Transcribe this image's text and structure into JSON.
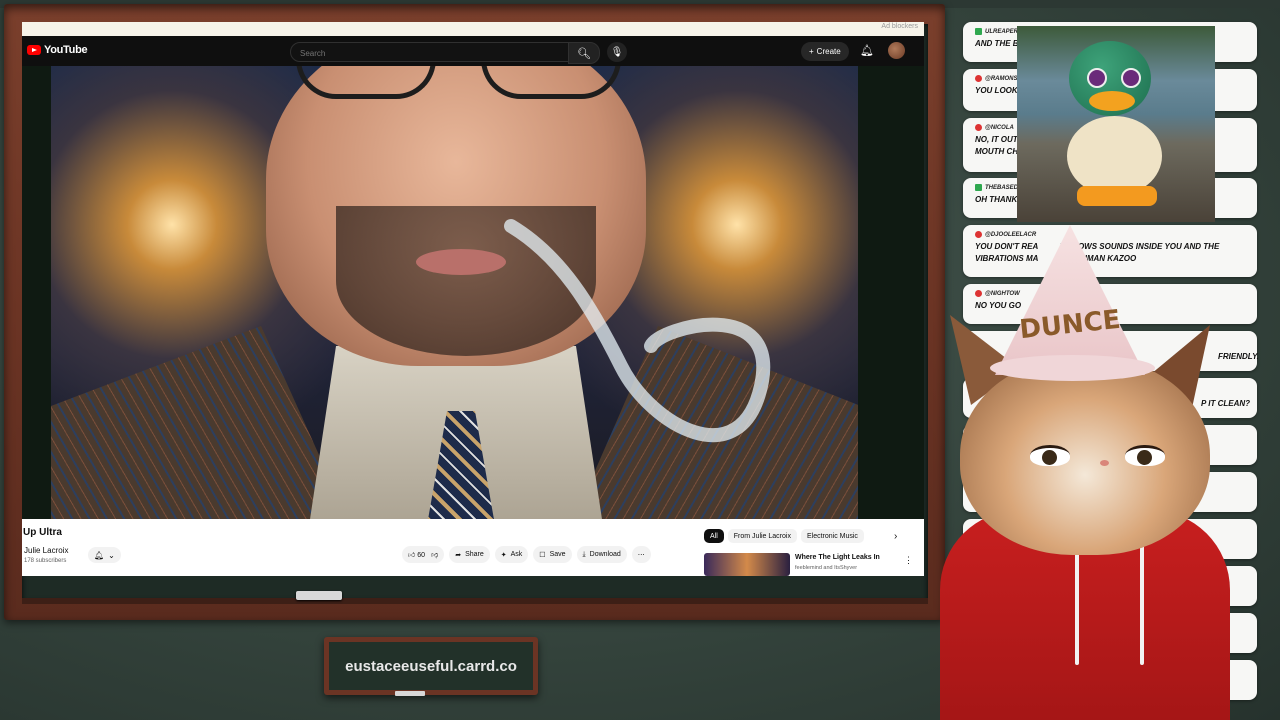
{
  "youtube": {
    "topstrip_hint": "Ad blockers",
    "logo_text": "YouTube",
    "search_placeholder": "Search",
    "create_label": "Create",
    "video_title": "Up Ultra",
    "channel_name": "Julie Lacroix",
    "subscribers": "178 subscribers",
    "like_count": "60",
    "actions": {
      "share": "Share",
      "ask": "Ask",
      "save": "Save",
      "download": "Download"
    },
    "chips": [
      "All",
      "From Julie Lacroix",
      "Electronic Music"
    ],
    "recommended": {
      "title": "Where The Light Leaks In",
      "channel": "feeblemind and ItsShyver"
    }
  },
  "sign_text": "eustaceeuseful.carrd.co",
  "hat_text": "DUNCE",
  "chat": [
    {
      "user": "ULREAPER",
      "text": "AND THE BE",
      "badge": "green"
    },
    {
      "user": "@RAMONS",
      "text": "YOU LOOK L                                              OUTH",
      "badge": "red"
    },
    {
      "user": "@NICOLA",
      "text": "NO, IT OUTP                                                R\nMOUTH CHA",
      "badge": "red"
    },
    {
      "user": "THEBASED",
      "text": "OH THANK Y",
      "badge": "green"
    },
    {
      "user": "@DJOOLEELACR",
      "text": "YOU DON'T REA          T BLOWS SOUNDS INSIDE YOU AND THE\nVIBRATIONS MA          E A HUMAN KAZOO",
      "badge": "red"
    },
    {
      "user": "@NIGHTOW",
      "text": "NO YOU GO",
      "badge": "red"
    },
    {
      "user": "",
      "text": "FRIENDLY.",
      "badge": ""
    },
    {
      "user": "",
      "text": "P IT CLEAN?",
      "badge": ""
    },
    {
      "user": "",
      "text": "",
      "badge": ""
    },
    {
      "user": "",
      "text": "VO",
      "badge": ""
    },
    {
      "user": "",
      "text": "",
      "badge": "red"
    },
    {
      "user": "",
      "text": "",
      "badge": ""
    },
    {
      "user": "",
      "text": "",
      "badge": ""
    },
    {
      "user": "",
      "text": "",
      "badge": ""
    }
  ],
  "colors": {
    "frame_wood": "#6b3424",
    "chalkboard": "#1e2b25",
    "youtube_red": "#ff0000",
    "hoodie_red": "#c81f1f"
  }
}
